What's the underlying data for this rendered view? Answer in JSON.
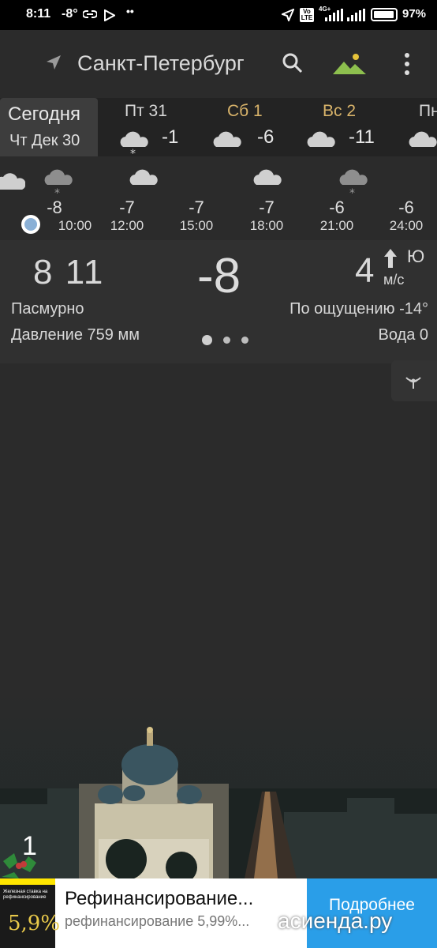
{
  "status_bar": {
    "time": "8:11",
    "temp": "-8°",
    "battery_pct": "97%",
    "network": "4G+",
    "volte": "Vo LTE",
    "battery_level": 0.97
  },
  "toolbar": {
    "city": "Санкт-Петербург",
    "icons": [
      "location-arrow-icon",
      "search-icon",
      "mountain-icon",
      "more-vert-icon"
    ]
  },
  "days": [
    {
      "label": "Сегодня",
      "date": "Чт Дек 30",
      "selected": true
    },
    {
      "label": "Пт 31",
      "temp": "-1",
      "icon": "snow-cloud-icon",
      "color": "#d6d6d6"
    },
    {
      "label": "Сб 1",
      "temp": "-6",
      "icon": "cloud-icon",
      "color": "#d8b36a"
    },
    {
      "label": "Вс 2",
      "temp": "-11",
      "icon": "cloud-icon",
      "color": "#d8b36a"
    },
    {
      "label": "Пн",
      "temp": "",
      "icon": "cloud-icon",
      "color": "#d6d6d6"
    }
  ],
  "hourly": [
    {
      "temp": "-8",
      "time": "10:00",
      "icon": "snow-cloud-icon"
    },
    {
      "temp": "-7",
      "time": "12:00",
      "icon": "cloud-icon"
    },
    {
      "temp": "-7",
      "time": "15:00",
      "icon": "cloud-icon"
    },
    {
      "temp": "-7",
      "time": "18:00",
      "icon": "cloud-icon"
    },
    {
      "temp": "-6",
      "time": "21:00",
      "icon": "snow-cloud-icon"
    },
    {
      "temp": "-6",
      "time": "24:00",
      "icon": "cloud-icon"
    }
  ],
  "current": {
    "clock": "8 11",
    "temp": "-8",
    "wind_speed": "4",
    "wind_dir": "Ю",
    "wind_unit": "м/с",
    "condition": "Пасмурно",
    "feels_like": "По ощущению -14°",
    "pressure": "Давление 759 мм",
    "water": "Вода 0",
    "pager_pages": 3,
    "pager_active": 0
  },
  "holiday_badge": {
    "number": "1"
  },
  "ad": {
    "thumb_text": "Железная ставка на рефинансирование",
    "thumb_big": "5,9%",
    "title": "Рефинансирование...",
    "subtitle": "рефинансирование 5,99%...",
    "cta": "Подробнее",
    "watermark": "асиенда.ру"
  },
  "colors": {
    "accent_day": "#d8b36a",
    "ad_cta": "#2a9ee8",
    "now_dot": "#8ab0d6"
  }
}
